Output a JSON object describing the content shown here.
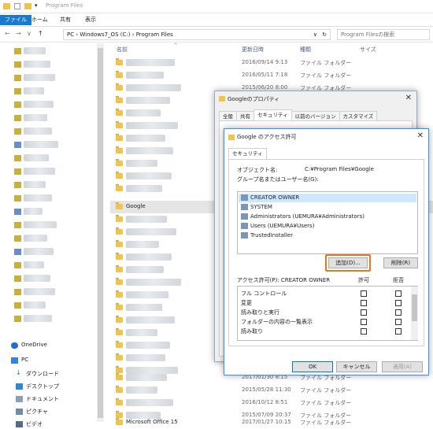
{
  "titlebar": {
    "title": "Program Files"
  },
  "ribbon": {
    "tabs": [
      "ファイル",
      "ホーム",
      "共有",
      "表示"
    ]
  },
  "address": {
    "path": "PC  ›  Windows7_OS (C:)  ›  Program Files",
    "search_placeholder": "Program Filesの検索"
  },
  "navpane": {
    "items": [
      "OneDrive",
      "PC",
      "ダウンロード",
      "デスクトップ",
      "ドキュメント",
      "ピクチャ",
      "ビデオ"
    ]
  },
  "columns": {
    "name": "名前",
    "date": "更新日時",
    "type": "種類",
    "size": "サイズ"
  },
  "rows_top": [
    {
      "date": "2016/09/14 9:13",
      "type": "ファイル フォルダー"
    },
    {
      "date": "2016/05/11 7:18",
      "type": "ファイル フォルダー"
    },
    {
      "date": "2015/06/20 8:00",
      "type": "ファイル フォルダー"
    }
  ],
  "rows_bottom": [
    {
      "name": "",
      "date": "2017/01/30 8:15",
      "type": "ファイル フォルダー"
    },
    {
      "name": "",
      "date": "2015/05/28 11:30",
      "type": "ファイル フォルダー"
    },
    {
      "name": "",
      "date": "2016/10/12 8:51",
      "type": "ファイル フォルダー"
    },
    {
      "name": "",
      "date": "2015/07/09 20:37",
      "type": "ファイル フォルダー"
    },
    {
      "name": "Microsoft Office 15",
      "date": "2017/01/27 10:15",
      "type": "ファイル フォルダー"
    }
  ],
  "google_row": "Google",
  "props": {
    "title": "Googleのプロパティ",
    "tabs": [
      "全般",
      "共有",
      "セキュリティ",
      "以前のバージョン",
      "カスタマイズ"
    ]
  },
  "acl": {
    "title": "Google のアクセス許可",
    "tab": "セキュリティ",
    "object_label": "オブジェクト名:",
    "object_value": "C:¥Program Files¥Google",
    "group_label": "グループ名またはユーザー名(G):",
    "users": [
      "CREATOR OWNER",
      "SYSTEM",
      "Administrators (UEMURA¥Administrators)",
      "Users (UEMURA¥Users)",
      "TrustedInstaller"
    ],
    "add_button": "追加(D)...",
    "remove_button": "削除(R)",
    "perm_header": "アクセス許可(P): CREATOR OWNER",
    "allow": "許可",
    "deny": "拒否",
    "permissions": [
      "フル コントロール",
      "変更",
      "読み取りと実行",
      "フォルダーの内容の一覧表示",
      "読み取り"
    ],
    "ok": "OK",
    "cancel": "キャンセル",
    "apply": "適用(A)"
  },
  "colors": {
    "accent": "#1979ca",
    "highlight": "#e87722",
    "selection": "#cce8ff"
  }
}
